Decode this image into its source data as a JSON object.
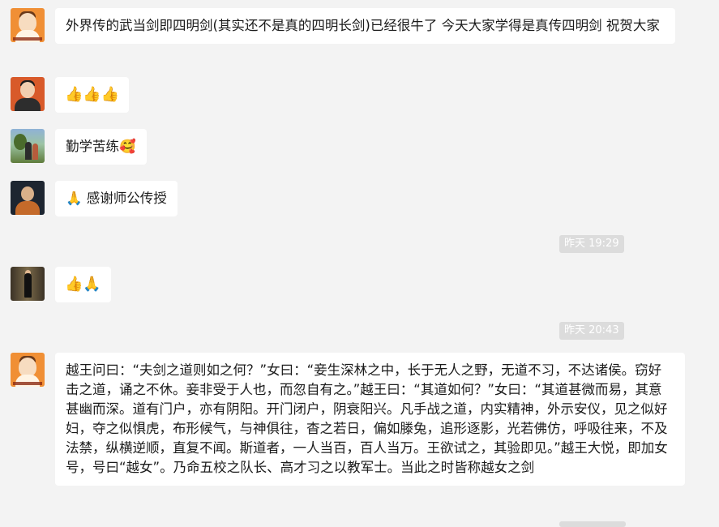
{
  "messages": [
    {
      "text": "外界传的武当剑即四明剑(其实还不是真的四明长剑)已经很牛了 今天大家学得是真传四明剑 祝贺大家"
    },
    {
      "text": "👍👍👍"
    },
    {
      "text": "勤学苦练🥰"
    },
    {
      "text": "🙏 感谢师公传授"
    },
    {
      "text": "👍🙏"
    },
    {
      "text": "越王问曰：“夫剑之道则如之何？”女曰：“妾生深林之中，长于无人之野，无道不习，不达诸侯。窃好击之道，诵之不休。妾非受于人也，而忽自有之。”越王曰：“其道如何？”女曰：“其道甚微而易，其意甚幽而深。道有门户，亦有阴阳。开门闭户，阴衰阳兴。凡手战之道，内实精神，外示安仪，见之似好妇，夺之似惧虎，布形候气，与神俱往，杳之若日，偏如滕兔，追形逐影，光若佛仿，呼吸往来，不及法禁，纵横逆顺，直复不闻。斯道者，一人当百，百人当万。王欲试之，其验即见。”越王大悦，即加女号，号曰“越女”。乃命五校之队长、高才习之以教军士。当此之时皆称越女之剑"
    }
  ],
  "timestamps": [
    "昨天 19:29",
    "昨天 20:43"
  ]
}
